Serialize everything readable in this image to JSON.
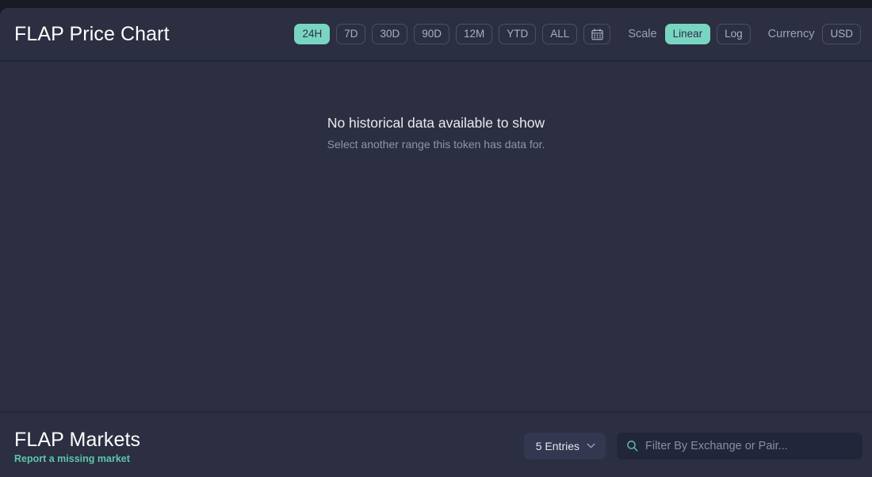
{
  "theme": {
    "page_background": "#181a24",
    "card_background": "#2b2f41",
    "accent": "#79d5c2",
    "link_accent": "#5fc4ae",
    "muted_text": "#8d95ab",
    "divider": "#23273a",
    "search_background": "#22263a"
  },
  "chart_panel": {
    "title": "FLAP Price Chart",
    "range_buttons": [
      {
        "label": "24H",
        "active": true
      },
      {
        "label": "7D",
        "active": false
      },
      {
        "label": "30D",
        "active": false
      },
      {
        "label": "90D",
        "active": false
      },
      {
        "label": "12M",
        "active": false
      },
      {
        "label": "YTD",
        "active": false
      },
      {
        "label": "ALL",
        "active": false
      }
    ],
    "calendar_button": {
      "icon": "calendar-icon"
    },
    "scale": {
      "label": "Scale",
      "options": [
        {
          "label": "Linear",
          "active": true
        },
        {
          "label": "Log",
          "active": false
        }
      ]
    },
    "currency": {
      "label": "Currency",
      "selected": "USD"
    },
    "empty_state": {
      "title": "No historical data available to show",
      "subtitle": "Select another range this token has data for."
    }
  },
  "markets_panel": {
    "title": "FLAP Markets",
    "report_link": "Report a missing market",
    "entries_select": {
      "value": "5 Entries",
      "icon": "chevron-down-icon"
    },
    "search": {
      "icon": "search-icon",
      "placeholder": "Filter By Exchange or Pair...",
      "value": ""
    }
  }
}
